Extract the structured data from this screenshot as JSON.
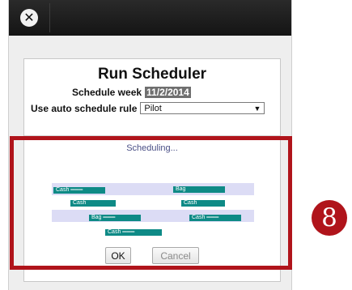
{
  "header": {
    "close_icon": "close-icon",
    "close_glyph": "✕"
  },
  "dialog": {
    "title": "Run Scheduler",
    "schedule_week_label": "Schedule week",
    "schedule_week_value": "11/2/2014",
    "auto_rule_label": "Use auto schedule rule",
    "auto_rule_value": "Pilot",
    "auto_rule_arrow": "▼",
    "scheduling_text": "Scheduling...",
    "ok_label": "OK",
    "cancel_label": "Cancel"
  },
  "schedule_bars": [
    {
      "label": "Cash  ═══"
    },
    {
      "label": "Bag"
    },
    {
      "label": "Cash"
    },
    {
      "label": "Cash"
    },
    {
      "label": "Bag   ═══"
    },
    {
      "label": "Cash  ═══"
    },
    {
      "label": "Cash  ═══"
    }
  ],
  "annotation": {
    "step_number": "8",
    "highlight_color": "#b0141b"
  },
  "colors": {
    "header": "#1c1c1c",
    "bar": "#0e8a86",
    "lane": "#dcdcf5",
    "scheduling_text": "#4a4f86"
  }
}
